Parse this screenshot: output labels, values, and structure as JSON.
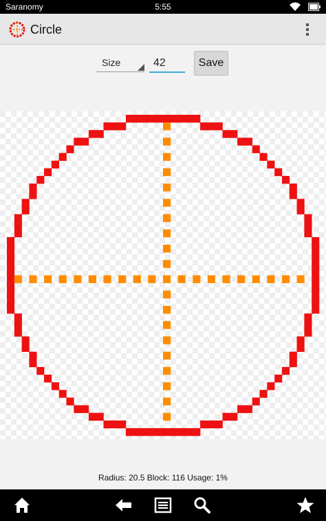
{
  "status_bar": {
    "app_name": "Saranomy",
    "time": "5:55"
  },
  "action_bar": {
    "title": "Circle",
    "icon": "crosshair-circle-icon",
    "overflow_icon": "overflow-menu-icon"
  },
  "controls": {
    "size_label": "Size",
    "size_value": "42",
    "save_label": "Save"
  },
  "grid": {
    "cells": 42,
    "circle_color": "#ee1111",
    "axis_color": "#ff8c00",
    "checker_light": "#ffffff",
    "checker_dark": "#eeeeee"
  },
  "info": {
    "text": "Radius: 20.5 Block: 116 Usage: 1%"
  },
  "nav_bar": {
    "icons": [
      "home-icon",
      "back-icon",
      "menu-icon",
      "search-icon",
      "star-icon"
    ]
  }
}
